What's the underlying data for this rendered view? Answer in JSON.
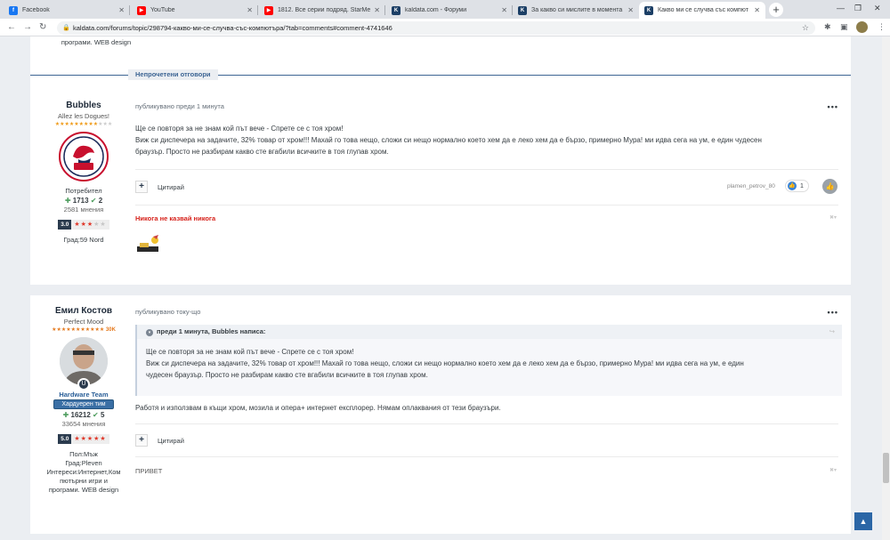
{
  "browser": {
    "tabs": [
      {
        "title": "Facebook",
        "color": "#1877f2",
        "glyph": "f"
      },
      {
        "title": "YouTube",
        "color": "#ff0000",
        "glyph": "▶"
      },
      {
        "title": "1812. Все серии подряд. StarMe",
        "color": "#ff0000",
        "glyph": "▶"
      },
      {
        "title": "kaldata.com - Форуми",
        "color": "#1c3f66",
        "glyph": "K"
      },
      {
        "title": "За какво си мислите в моментa",
        "color": "#1c3f66",
        "glyph": "K"
      },
      {
        "title": "Какво ми се случва със компют",
        "color": "#1c3f66",
        "glyph": "K"
      }
    ],
    "url": "kaldata.com/forums/topic/298794-какво-ми-се-случва-със-компютъра/?tab=comments#comment-4741646"
  },
  "top_signature": {
    "lines": [
      "програми. WEB design"
    ]
  },
  "unread_label": "Непрочетени отговори",
  "posts": [
    {
      "author": {
        "name": "Bubbles",
        "title": "Allez les Dogues!",
        "group": "Потребител",
        "rep_plus": "1713",
        "rep_check": "2",
        "posts": "2581 мнения",
        "rating": "3.0",
        "city": "Град:59 Nord"
      },
      "meta": "публикувано преди 1 минута",
      "body": [
        "Ще се повторя за не знам кой път вече - Спрете се с тоя хром!",
        "Виж си диспечера на задачите, 32% товар от хром!!! Махай го това нещо, сложи си нещо нормално което хем да е леко хем да е бързо, примерно Мура! ми идва сега на ум, е един чудесен",
        "браузър. Просто не разбирам какво сте вгабили всичките в тоя глупав хром."
      ],
      "quote_label": "Цитирай",
      "reactor": "plamen_petrov_80",
      "reaction_count": "1",
      "signature": "Никога не казвай никога"
    },
    {
      "author": {
        "name": "Емил Костов",
        "title": "Perfect Mood",
        "stars_label": "30K",
        "team": "Hardware Team",
        "badge": "Хардуерен тим",
        "rep_plus": "16212",
        "rep_check": "5",
        "posts": "33654 мнения",
        "rating": "5.0",
        "gender": "Пол:Мъж",
        "city": "Град:Pleven",
        "interests": [
          "Интереси:Интернет,Ком",
          "пютърни игри и",
          "програми. WEB design"
        ]
      },
      "meta": "публикувано току-що",
      "quote": {
        "header": "преди 1 минута, Bubbles написа:",
        "lines": [
          "Ще се повторя за не знам кой път вече - Спрете се с тоя хром!",
          "Виж си диспечера на задачите, 32% товар от хром!!! Махай го това нещо, сложи си нещо нормално което хем да е леко хем да е бързо, примерно Мура! ми идва сега на ум, е един",
          "чудесен браузър. Просто не разбирам какво сте вгабили всичките в тоя глупав хром."
        ]
      },
      "body": [
        "Работя и използвам в къщи хром, мозила и опера+ интернет експлорер. Нямам оплаквания от тези браузъри."
      ],
      "quote_label": "Цитирай",
      "signature": "ПРИВЕТ"
    }
  ]
}
